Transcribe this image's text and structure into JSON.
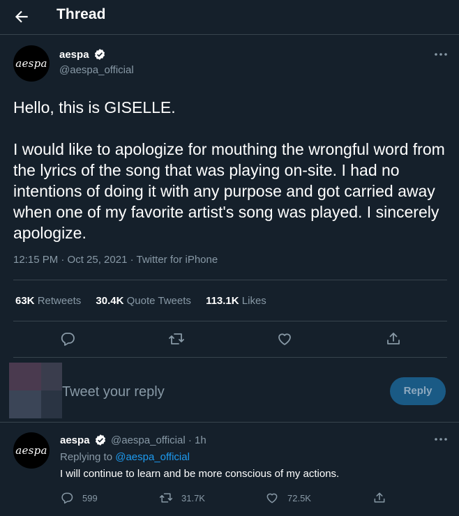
{
  "header": {
    "title": "Thread"
  },
  "main_tweet": {
    "avatar_text": "aespa",
    "name": "aespa",
    "handle": "@aespa_official",
    "text": "Hello, this is GISELLE.\n\nI would like to apologize for mouthing the wrongful word from the lyrics of the song that was playing on-site. I had no intentions of doing it with any purpose and got carried away when one of my favorite artist's song was played. I sincerely apologize.",
    "meta": "12:15 PM · Oct 25, 2021 · Twitter for iPhone",
    "stats": {
      "retweets_count": "63K",
      "retweets_label": "Retweets",
      "quotes_count": "30.4K",
      "quotes_label": "Quote Tweets",
      "likes_count": "113.1K",
      "likes_label": "Likes"
    }
  },
  "reply_box": {
    "placeholder": "Tweet your reply",
    "button_label": "Reply"
  },
  "reply_tweet": {
    "avatar_text": "aespa",
    "name": "aespa",
    "handle_time": "@aespa_official · 1h",
    "replying_prefix": "Replying to",
    "replying_handle": "@aespa_official",
    "text": "I will continue to learn and be more conscious of my actions.",
    "replies": "599",
    "retweets": "31.7K",
    "likes": "72.5K"
  },
  "colors": {
    "background": "#15202b",
    "border": "#38444d",
    "muted": "#8899a6",
    "accent": "#1d9bf0"
  },
  "icons": [
    "back-arrow-icon",
    "verified-badge-icon",
    "more-icon",
    "reply-icon",
    "retweet-icon",
    "like-icon",
    "share-icon"
  ]
}
